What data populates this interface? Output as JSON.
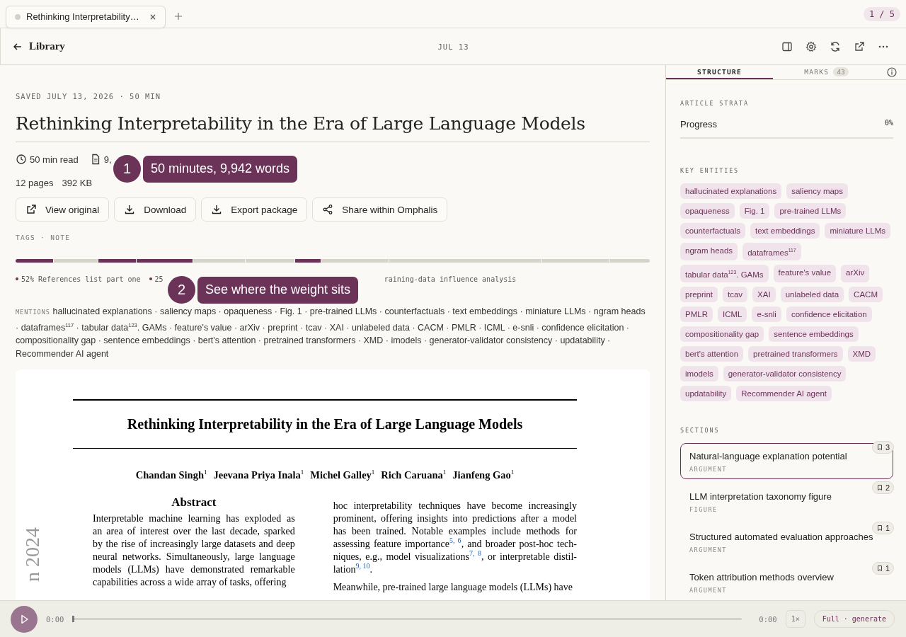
{
  "tabs": [
    {
      "title": "Rethinking Interpretability…",
      "selected": true
    }
  ],
  "tab_counter": "1 / 5",
  "header": {
    "back": "Library",
    "date": "JUL 13"
  },
  "article": {
    "saved": "SAVED JULY 13, 2026 · 50 MIN",
    "title": "Rethinking Interpretability in the Era of Large Language Models",
    "meta": [
      {
        "kind": "clock",
        "text": "50 min read"
      },
      {
        "kind": "doc",
        "text": "9,"
      }
    ],
    "stats": [
      "12 pages",
      "392 KB"
    ],
    "actions": [
      {
        "kind": "external",
        "label": "View original"
      },
      {
        "kind": "download",
        "label": "Download"
      },
      {
        "kind": "download",
        "label": "Export package"
      },
      {
        "kind": "share",
        "label": "Share within Omphalis"
      }
    ],
    "tags": "TAGS · NOTE",
    "strata": [
      {
        "marked": true
      },
      {
        "marked": false
      },
      {
        "marked": true
      },
      {
        "marked": true
      },
      {
        "marked": false
      },
      {
        "marked": false
      },
      {
        "marked": true
      },
      {
        "marked": false
      },
      {
        "marked": false
      },
      {
        "marked": false
      },
      {
        "marked": false
      }
    ],
    "legend": [
      "52% References list part one",
      "25"
    ],
    "legend_tail": "raining-data influence analysis",
    "mentions_label": "MENTIONS",
    "mentions": "hallucinated explanations · saliency maps · opaqueness · Fig. 1 · pre-trained LLMs · counterfactuals · text embeddings · miniature LLMs · ngram heads · dataframes$^{117}$ · tabular data$^{123}$. GAMs · feature's value · arXiv · preprint · tcav · XAI · unlabeled data · CACM · PMLR · ICML · e-snli · confidence elicitation · compositionality gap · sentence embeddings · bert's attention · pretrained transformers · XMD · imodels · generator-validator consistency · updatability · Recommender AI agent"
  },
  "paper": {
    "title": "Rethinking Interpretability in the Era of Large Language Models",
    "authors": [
      "Chandan Singh$^{1}$",
      "Jeevana Priya Inala$^{1}$",
      "Michel Galley$^{1}$",
      "Rich Caruana$^{1}$",
      "Jianfeng Gao$^{1}$"
    ],
    "side_stamp": "n 2024",
    "abstract_heading": "Abstract",
    "left_lines": [
      "Interpretable machine learning has exploded as",
      "an area of interest over the last decade, sparked",
      "by the rise of increasingly large datasets and deep",
      "neural networks. Simultaneously, large language",
      "models (LLMs) have demonstrated remarkable",
      "capabilities across a wide array of tasks, offering"
    ],
    "right_paragraphs": [
      [
        "hoc interpretability techniques have become increasingly",
        "prominent, offering insights into predictions after a model",
        "has been trained.  Notable examples include methods for",
        "assessing feature importance$^{5, 6}$, and broader post-hoc tech-",
        "niques, e.g., model visualizations$^{7, 8}$, or interpretable distil-",
        "lation$^{9, 10}$."
      ],
      [
        "Meanwhile, pre-trained large language models (LLMs) have"
      ]
    ]
  },
  "callouts": [
    {
      "number": "1",
      "text": "50 minutes, 9,942 words"
    },
    {
      "number": "2",
      "text": "See where the weight sits"
    }
  ],
  "panel": {
    "tabs": [
      {
        "label": "STRUCTURE",
        "selected": true
      },
      {
        "label": "MARKS",
        "count": "43",
        "selected": false
      }
    ],
    "strata_heading": "ARTICLE STRATA",
    "progress": {
      "label": "Progress",
      "value": "0%",
      "level": 0
    },
    "entities_heading": "KEY ENTITIES",
    "entities": [
      "hallucinated explanations",
      "saliency maps",
      "opaqueness",
      "Fig. 1",
      "pre-trained LLMs",
      "counterfactuals",
      "text embeddings",
      "miniature LLMs",
      "ngram heads",
      "dataframes$^{117}$",
      "tabular data$^{123}$. GAMs",
      "feature's value",
      "arXiv",
      "preprint",
      "tcav",
      "XAI",
      "unlabeled data",
      "CACM",
      "PMLR",
      "ICML",
      "e-snli",
      "confidence elicitation",
      "compositionality gap",
      "sentence embeddings",
      "bert's attention",
      "pretrained transformers",
      "XMD",
      "imodels",
      "generator-validator consistency",
      "updatability",
      "Recommender AI agent"
    ],
    "sections_heading": "SECTIONS",
    "sections": [
      {
        "title": "Natural-language explanation potential",
        "type": "ARGUMENT",
        "marks": "3",
        "selected": true
      },
      {
        "title": "LLM interpretation taxonomy figure",
        "type": "FIGURE",
        "marks": "2",
        "selected": false
      },
      {
        "title": "Structured automated evaluation approaches",
        "type": "ARGUMENT",
        "marks": "1",
        "selected": false
      },
      {
        "title": "Token attribution methods overview",
        "type": "ARGUMENT",
        "marks": "1",
        "selected": false
      }
    ]
  },
  "player": {
    "playing": false,
    "elapsed": "0:00",
    "level": 0,
    "total": "0:00",
    "speed": "1×",
    "mode": "Full · generate"
  }
}
